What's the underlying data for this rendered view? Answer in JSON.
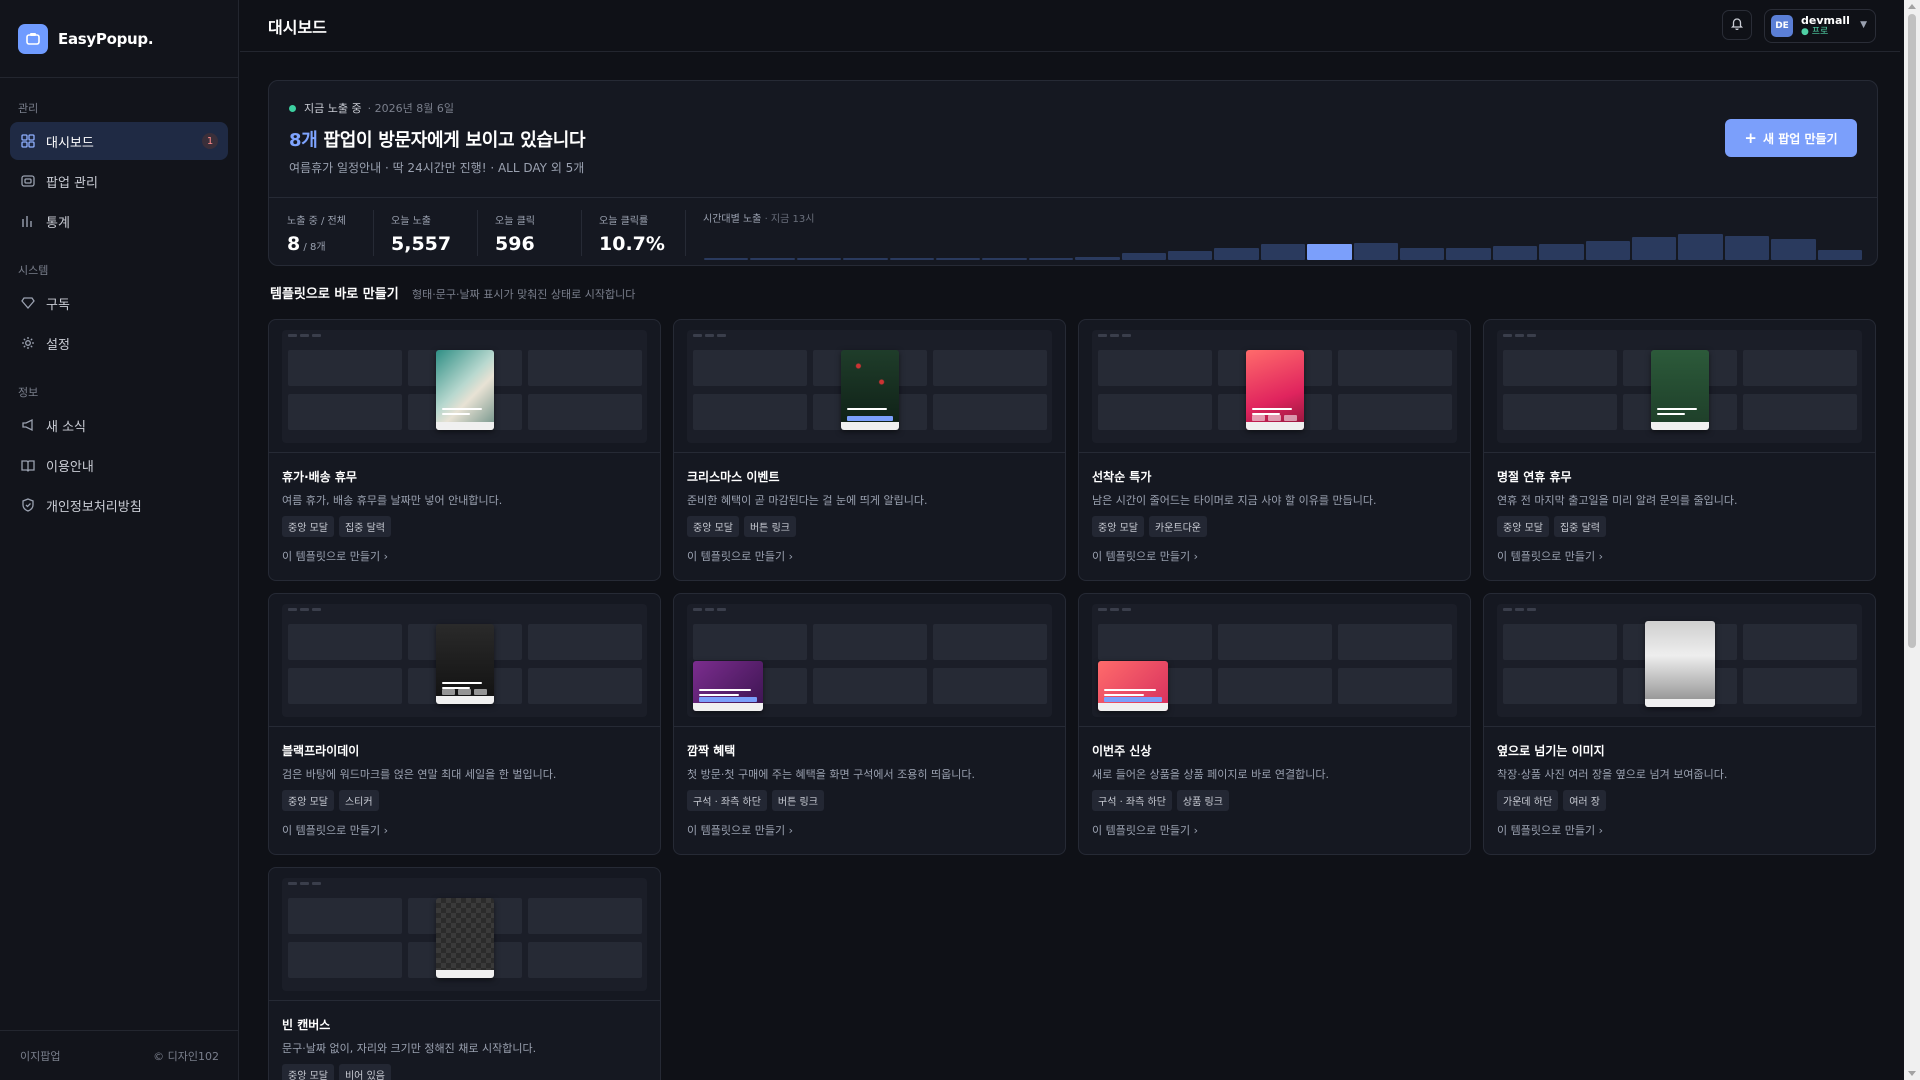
{
  "brand": {
    "name": "EasyPopup."
  },
  "sidebar": {
    "sections": [
      {
        "title": "관리",
        "items": [
          {
            "label": "대시보드",
            "icon": "grid-icon",
            "active": true,
            "badge": "1"
          },
          {
            "label": "팝업 관리",
            "icon": "window-icon"
          },
          {
            "label": "통계",
            "icon": "bar-chart-icon"
          }
        ]
      },
      {
        "title": "시스템",
        "items": [
          {
            "label": "구독",
            "icon": "gem-icon"
          },
          {
            "label": "설정",
            "icon": "gear-icon"
          }
        ]
      },
      {
        "title": "정보",
        "items": [
          {
            "label": "새 소식",
            "icon": "megaphone-icon"
          },
          {
            "label": "이용안내",
            "icon": "book-icon"
          },
          {
            "label": "개인정보처리방침",
            "icon": "shield-icon"
          }
        ]
      }
    ],
    "footer": {
      "left": "이지팝업",
      "right": "© 디자인102"
    }
  },
  "topbar": {
    "title": "대시보드",
    "user": {
      "initials": "DE",
      "name": "devmall",
      "plan": "● 프로"
    }
  },
  "hero": {
    "status": "지금 노출 중",
    "date": "2026년 8월 6일",
    "count": "8개",
    "headline": " 팝업이 방문자에게 보이고 있습니다",
    "subtitle": "여름휴가 일정안내 · 딱 24시간만 진행! · ALL DAY 외 5개",
    "cta": "새 팝업 만들기",
    "stats": [
      {
        "label": "노출 중 / 전체",
        "value": "8",
        "suffix": " / 8개"
      },
      {
        "label": "오늘 노출",
        "value": "5,557"
      },
      {
        "label": "오늘 클릭",
        "value": "596"
      },
      {
        "label": "오늘 클릭률",
        "value": "10.7%"
      }
    ],
    "hourly": {
      "title": "시간대별 노출",
      "note": " · 지금 13시",
      "current_hour": 13,
      "values": [
        1,
        1,
        1,
        1,
        1,
        1,
        1,
        1,
        2,
        4,
        5,
        7,
        9,
        9,
        10,
        7,
        7,
        8,
        9,
        11,
        13,
        15,
        14,
        12,
        6
      ]
    }
  },
  "templates_section": {
    "title": "템플릿으로 바로 만들기",
    "subtitle": "형태·문구·날짜 표시가 맞춰진 상태로 시작합니다",
    "cta_label": "이 템플릿으로 만들기 ›",
    "cards": [
      {
        "name": "휴가·배송 휴무",
        "desc": "여름 휴가, 배송 휴무를 날짜만 넣어 안내합니다.",
        "tags": [
          "중앙 모달",
          "집중 달력"
        ]
      },
      {
        "name": "크리스마스 이벤트",
        "desc": "준비한 혜택이 곧 마감된다는 걸 눈에 띄게 알립니다.",
        "tags": [
          "중앙 모달",
          "버튼 링크"
        ]
      },
      {
        "name": "선착순 특가",
        "desc": "남은 시간이 줄어드는 타이머로 지금 사야 할 이유를 만듭니다.",
        "tags": [
          "중앙 모달",
          "카운트다운"
        ]
      },
      {
        "name": "명절 연휴 휴무",
        "desc": "연휴 전 마지막 출고일을 미리 알려 문의를 줄입니다.",
        "tags": [
          "중앙 모달",
          "집중 달력"
        ]
      },
      {
        "name": "블랙프라이데이",
        "desc": "검은 바탕에 워드마크를 얹은 연말 최대 세일을 한 벌입니다.",
        "tags": [
          "중앙 모달",
          "스티커"
        ]
      },
      {
        "name": "깜짝 혜택",
        "desc": "첫 방문·첫 구매에 주는 혜택을 화면 구석에서 조용히 띄웁니다.",
        "tags": [
          "구석 · 좌측 하단",
          "버튼 링크"
        ]
      },
      {
        "name": "이번주 신상",
        "desc": "새로 들어온 상품을 상품 페이지로 바로 연결합니다.",
        "tags": [
          "구석 · 좌측 하단",
          "상품 링크"
        ]
      },
      {
        "name": "옆으로 넘기는 이미지",
        "desc": "착장·상품 사진 여러 장을 옆으로 넘겨 보여줍니다.",
        "tags": [
          "가운데 하단",
          "여러 장"
        ]
      },
      {
        "name": "빈 캔버스",
        "desc": "문구·날짜 없이, 자리와 크기만 정해진 채로 시작합니다.",
        "tags": [
          "중앙 모달",
          "비어 있음"
        ]
      }
    ]
  },
  "colors": {
    "accent": "#7b9ffb",
    "live": "#3ccfa0",
    "background": "#0f1117"
  }
}
